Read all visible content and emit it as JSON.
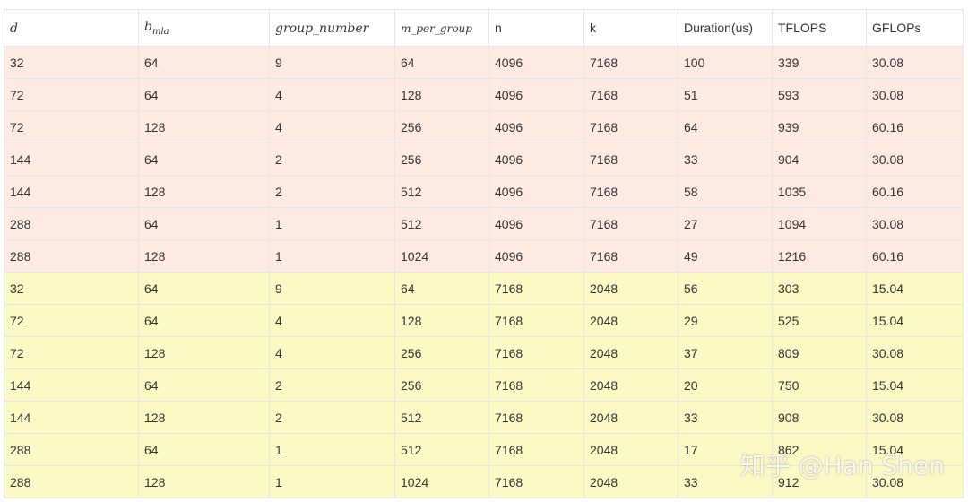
{
  "table": {
    "headers": [
      "d",
      "b_mla",
      "group_number",
      "m_per_group",
      "n",
      "k",
      "Duration(us)",
      "TFLOPS",
      "GFLOPs"
    ],
    "header_sub": "mla",
    "groups": [
      {
        "color": "#fdeae2",
        "rows": [
          [
            "32",
            "64",
            "9",
            "64",
            "4096",
            "7168",
            "100",
            "339",
            "30.08"
          ],
          [
            "72",
            "64",
            "4",
            "128",
            "4096",
            "7168",
            "51",
            "593",
            "30.08"
          ],
          [
            "72",
            "128",
            "4",
            "256",
            "4096",
            "7168",
            "64",
            "939",
            "60.16"
          ],
          [
            "144",
            "64",
            "2",
            "256",
            "4096",
            "7168",
            "33",
            "904",
            "30.08"
          ],
          [
            "144",
            "128",
            "2",
            "512",
            "4096",
            "7168",
            "58",
            "1035",
            "60.16"
          ],
          [
            "288",
            "64",
            "1",
            "512",
            "4096",
            "7168",
            "27",
            "1094",
            "30.08"
          ],
          [
            "288",
            "128",
            "1",
            "1024",
            "4096",
            "7168",
            "49",
            "1216",
            "60.16"
          ]
        ]
      },
      {
        "color": "#fbf9c4",
        "rows": [
          [
            "32",
            "64",
            "9",
            "64",
            "7168",
            "2048",
            "56",
            "303",
            "15.04"
          ],
          [
            "72",
            "64",
            "4",
            "128",
            "7168",
            "2048",
            "29",
            "525",
            "15.04"
          ],
          [
            "72",
            "128",
            "4",
            "256",
            "7168",
            "2048",
            "37",
            "809",
            "30.08"
          ],
          [
            "144",
            "64",
            "2",
            "256",
            "7168",
            "2048",
            "20",
            "750",
            "15.04"
          ],
          [
            "144",
            "128",
            "2",
            "512",
            "7168",
            "2048",
            "33",
            "908",
            "30.08"
          ],
          [
            "288",
            "64",
            "1",
            "512",
            "7168",
            "2048",
            "17",
            "862",
            "15.04"
          ],
          [
            "288",
            "128",
            "1",
            "1024",
            "7168",
            "2048",
            "33",
            "912",
            "30.08"
          ]
        ]
      }
    ]
  },
  "watermark": "知乎 @Han Shen"
}
